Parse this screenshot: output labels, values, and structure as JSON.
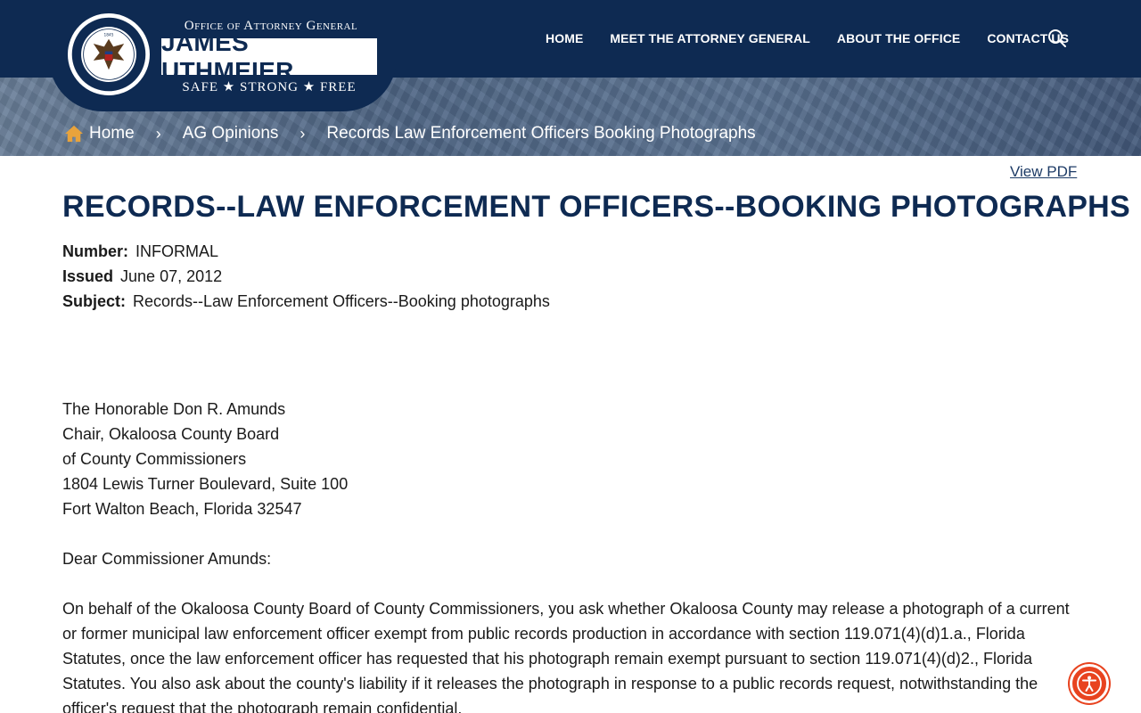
{
  "header": {
    "office_line": "Office of Attorney General",
    "name": "JAMES UTHMEIER",
    "tagline": "SAFE ★ STRONG ★ FREE",
    "seal_text_top": "ATTORNEY GENERAL",
    "seal_text_bottom": "THE STATE OF FLORIDA",
    "nav": [
      {
        "label": "HOME"
      },
      {
        "label": "MEET THE ATTORNEY GENERAL"
      },
      {
        "label": "ABOUT THE OFFICE"
      },
      {
        "label": "CONTACT US"
      }
    ],
    "search_icon": "search-icon",
    "colors": {
      "navy": "#0e2a52",
      "home_icon": "#e8a33c"
    }
  },
  "breadcrumb": {
    "home": "Home",
    "level2": "AG Opinions",
    "current": "Records Law Enforcement Officers Booking Photographs",
    "separator": "›"
  },
  "document": {
    "view_pdf": "View PDF",
    "title": "RECORDS--LAW ENFORCEMENT OFFICERS--BOOKING PHOTOGRAPHS",
    "meta": {
      "number_label": "Number:",
      "number_value": "INFORMAL",
      "issued_label": "Issued",
      "issued_value": "June 07, 2012",
      "subject_label": "Subject:",
      "subject_value": "Records--Law Enforcement Officers--Booking photographs"
    },
    "address": [
      "The Honorable Don R. Amunds",
      "Chair, Okaloosa County Board",
      "of County Commissioners",
      "1804 Lewis Turner Boulevard, Suite 100",
      "Fort Walton Beach, Florida 32547"
    ],
    "greeting": "Dear Commissioner Amunds:",
    "paragraph": "On behalf of the Okaloosa County Board of County Commissioners, you ask whether Okaloosa County may release a photograph of a current or former municipal law enforcement officer exempt from public records production in accordance with section 119.071(4)(d)1.a., Florida Statutes, once the law enforcement officer has requested that his photograph remain exempt pursuant to section 119.071(4)(d)2., Florida Statutes. You also ask about the county's liability if it releases the photograph in response to a public records request, notwithstanding the officer's request that the photograph remain confidential."
  },
  "accessibility": {
    "icon": "accessibility-icon",
    "color": "#e8431f"
  }
}
